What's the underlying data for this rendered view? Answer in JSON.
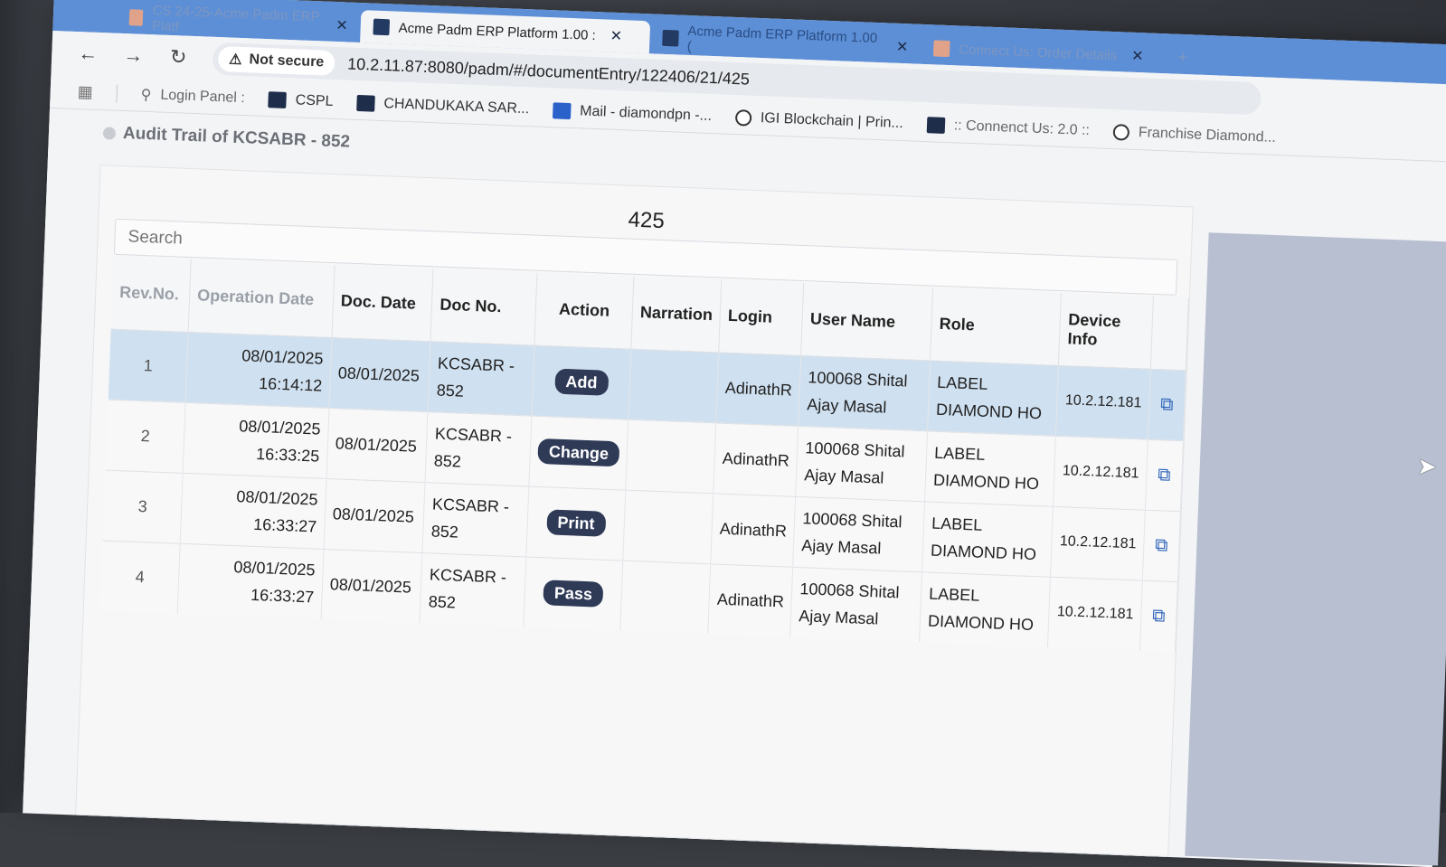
{
  "browser": {
    "tabs": [
      {
        "label": "CS 24-25-Acme Padm ERP Platf",
        "state": "faint"
      },
      {
        "label": "Acme Padm ERP Platform 1.00 :",
        "state": "active"
      },
      {
        "label": "Acme Padm ERP Platform 1.00 (",
        "state": "inactive"
      },
      {
        "label": "Connect Us: Order Details",
        "state": "faint"
      }
    ],
    "close_glyph": "✕",
    "new_tab_glyph": "+",
    "security_label": "Not secure",
    "url": "10.2.11.87:8080/padm/#/documentEntry/122406/21/425"
  },
  "bookmarks": [
    {
      "label": "Login Panel :",
      "icon": "login-icon"
    },
    {
      "label": "CSPL",
      "icon": "site-icon"
    },
    {
      "label": "CHANDUKAKA SAR...",
      "icon": "site-icon"
    },
    {
      "label": "Mail - diamondpn -...",
      "icon": "outlook-icon"
    },
    {
      "label": "IGI Blockchain | Prin...",
      "icon": "igi-icon"
    },
    {
      "label": ":: Connenct Us: 2.0 ::",
      "icon": "site-icon"
    },
    {
      "label": "Franchise Diamond...",
      "icon": "globe-icon"
    }
  ],
  "page": {
    "title": "Audit Trail of KCSABR - 852",
    "doc_number": "425",
    "search_placeholder": "Search"
  },
  "table": {
    "headers": [
      "Rev.No.",
      "Operation Date",
      "Doc. Date",
      "Doc No.",
      "Action",
      "Narration",
      "Login",
      "User Name",
      "Role",
      "Device Info"
    ],
    "rows": [
      {
        "rev": "1",
        "op_date": "08/01/2025",
        "op_time": "16:14:12",
        "doc_date": "08/01/2025",
        "doc_no_1": "KCSABR -",
        "doc_no_2": "852",
        "action": "Add",
        "narration": "",
        "login": "AdinathR",
        "user_1": "100068 Shital",
        "user_2": "Ajay Masal",
        "role_1": "LABEL",
        "role_2": "DIAMOND HO",
        "device": "10.2.12.181"
      },
      {
        "rev": "2",
        "op_date": "08/01/2025",
        "op_time": "16:33:25",
        "doc_date": "08/01/2025",
        "doc_no_1": "KCSABR -",
        "doc_no_2": "852",
        "action": "Change",
        "narration": "",
        "login": "AdinathR",
        "user_1": "100068 Shital",
        "user_2": "Ajay Masal",
        "role_1": "LABEL",
        "role_2": "DIAMOND HO",
        "device": "10.2.12.181"
      },
      {
        "rev": "3",
        "op_date": "08/01/2025",
        "op_time": "16:33:27",
        "doc_date": "08/01/2025",
        "doc_no_1": "KCSABR -",
        "doc_no_2": "852",
        "action": "Print",
        "narration": "",
        "login": "AdinathR",
        "user_1": "100068 Shital",
        "user_2": "Ajay Masal",
        "role_1": "LABEL",
        "role_2": "DIAMOND HO",
        "device": "10.2.12.181"
      },
      {
        "rev": "4",
        "op_date": "08/01/2025",
        "op_time": "16:33:27",
        "doc_date": "08/01/2025",
        "doc_no_1": "KCSABR -",
        "doc_no_2": "852",
        "action": "Pass",
        "narration": "",
        "login": "AdinathR",
        "user_1": "100068 Shital",
        "user_2": "Ajay Masal",
        "role_1": "LABEL",
        "role_2": "DIAMOND HO",
        "device": "10.2.12.181"
      }
    ]
  },
  "colors": {
    "tab_strip": "#5d8fd6",
    "selected_row": "#cfe0f0",
    "badge": "#2f3a57",
    "link_icon": "#2e63b8"
  }
}
